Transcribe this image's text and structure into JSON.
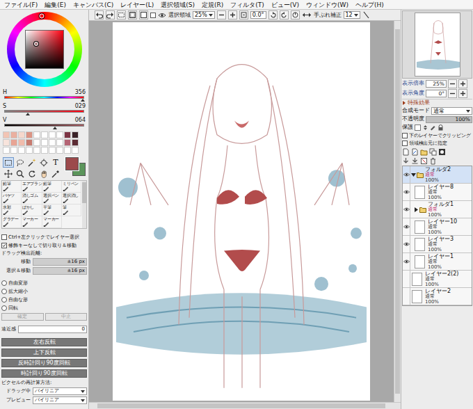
{
  "menu": [
    "ファイル(F)",
    "編集(E)",
    "キャンバス(C)",
    "レイヤー(L)",
    "選択領域(S)",
    "定規(R)",
    "フィルタ(T)",
    "ビュー(V)",
    "ウィンドウ(W)",
    "ヘルプ(H)"
  ],
  "color_panel": {
    "sliders": [
      {
        "label": "H",
        "value": "356",
        "level": 0.99
      },
      {
        "label": "S",
        "value": "029",
        "level": 0.29
      },
      {
        "label": "V",
        "value": "064",
        "level": 0.64
      }
    ],
    "swatches": [
      {
        "color": "#f2c4b4"
      },
      {
        "color": "#eab0a0"
      },
      {
        "color": "#f6d8cc"
      },
      {
        "color": "#dc9484"
      },
      {
        "color": "#ffffff"
      },
      {
        "color": "#ffffff"
      },
      {
        "color": "#ffffff"
      },
      {
        "color": "#ffffff"
      },
      {
        "color": "#7c3444"
      },
      {
        "color": "#3a2228"
      },
      {
        "color": "#f8e4dc"
      },
      {
        "color": "#e8a494"
      },
      {
        "color": "#f0bcac"
      },
      {
        "color": "#c87c70"
      },
      {
        "color": "#ffffff"
      },
      {
        "color": "#ffffff"
      },
      {
        "color": "#ffffff"
      },
      {
        "color": "#ffffff"
      },
      {
        "color": "#b46474"
      },
      {
        "color": "#5c2c34"
      },
      {
        "color": "#ffffff"
      },
      {
        "color": "#ffffff"
      },
      {
        "color": "#ffffff"
      },
      {
        "color": "#ffffff"
      },
      {
        "color": "#ffffff"
      },
      {
        "color": "#ffffff"
      },
      {
        "color": "#ffffff"
      },
      {
        "color": "#ffffff"
      },
      {
        "color": "#ffffff"
      },
      {
        "color": "#ffffff"
      }
    ],
    "current": [
      {
        "color": "#9c4a4c",
        "selected": true
      },
      {
        "color": "#5b955b",
        "selected": false
      }
    ]
  },
  "tool_icons": [
    {
      "selected": true
    },
    {
      "selected": false
    },
    {
      "selected": false
    },
    {
      "selected": false
    },
    {
      "text": "T",
      "selected": false
    },
    {
      "selected": false
    },
    {
      "selected": false
    },
    {
      "selected": false
    },
    {
      "selected": false
    },
    {
      "selected": false
    }
  ],
  "brushes": [
    "鉛筆",
    "エアブラシ",
    "鉛筆",
    "ミリペン",
    "バケツ",
    "消しゴム",
    "選択ペン",
    "選択消し",
    "水彩",
    "ぼかし",
    "平筆",
    "筆",
    "グラデー",
    "マーカー",
    "マーカー"
  ],
  "tool_options": {
    "checkboxes": [
      {
        "label": "Ctrl+左クリックでレイヤー選択",
        "checked": false
      },
      {
        "label": "修飾キーなしで切り取り＆移動",
        "checked": true
      }
    ],
    "drag_title": "ドラッグ検出距離:",
    "drag_rows": [
      {
        "label": "移動",
        "value": "±16 px"
      },
      {
        "label": "選択＆移動",
        "value": "±16 px"
      }
    ],
    "transforms": [
      {
        "label": "自由変形",
        "selected": false
      },
      {
        "label": "拡大縮小",
        "selected": false
      },
      {
        "label": "自由な形",
        "selected": false
      },
      {
        "label": "回転",
        "selected": false
      }
    ],
    "confirm_buttons": [
      {
        "label": "確定",
        "disabled": true
      },
      {
        "label": "中止",
        "disabled": true
      }
    ],
    "perspective": {
      "label": "遠近感",
      "value": "0"
    },
    "actions": [
      "左右反転",
      "上下反転",
      "反時計回り90度回転",
      "時計回り90度回転"
    ],
    "resample_title": "ピクセルの再計算方法:",
    "resample": [
      {
        "label": "ドラッグ中",
        "value": "バイリニア"
      },
      {
        "label": "プレビュー",
        "value": "バイリニア"
      }
    ]
  },
  "canvas_toolbar": {
    "selection_checked": false,
    "selection_label": "選択領域",
    "zoom": "25%",
    "angle": "0.0°",
    "stabilizer_label": "手ぶれ補正",
    "stabilizer": "12"
  },
  "navigator": {
    "zoom_label": "表示倍率",
    "zoom": "25%",
    "angle_label": "表示角度",
    "angle": "0°"
  },
  "layer_props": {
    "section": "特殊効果",
    "blend_label": "合成モード",
    "blend": "通常",
    "opacity_label": "不透明度",
    "opacity": "100%",
    "opacity_level": 1,
    "protect_label": "保護",
    "checkboxes": [
      {
        "label": "下のレイヤーでクリッピング",
        "checked": false
      },
      {
        "label": "領域検出元に指定",
        "checked": false
      }
    ]
  },
  "layers": [
    {
      "name": "フォルダ2",
      "mode": "通常",
      "opacity": "100%",
      "kind": "folder",
      "visible": true,
      "selected": true,
      "expanded": true,
      "children": [
        {
          "name": "レイヤー8",
          "mode": "通常",
          "opacity": "100%",
          "kind": "layer",
          "visible": true,
          "selected": false
        },
        {
          "name": "フォルダ1",
          "mode": "通常",
          "opacity": "100%",
          "kind": "folder",
          "visible": true,
          "selected": false,
          "expanded": false,
          "children": []
        },
        {
          "name": "レイヤー10",
          "mode": "通常",
          "opacity": "100%",
          "kind": "layer",
          "visible": true,
          "selected": false
        },
        {
          "name": "レイヤー3",
          "mode": "通常",
          "opacity": "100%",
          "kind": "layer",
          "visible": true,
          "selected": false
        },
        {
          "name": "レイヤー1",
          "mode": "通常",
          "opacity": "100%",
          "kind": "layer",
          "visible": true,
          "selected": false
        }
      ]
    },
    {
      "name": "レイヤー2(2)",
      "mode": "通常",
      "opacity": "100%",
      "kind": "layer",
      "visible": false,
      "selected": false
    },
    {
      "name": "レイヤー2",
      "mode": "通常",
      "opacity": "100%",
      "kind": "layer",
      "visible": false,
      "selected": false
    }
  ]
}
